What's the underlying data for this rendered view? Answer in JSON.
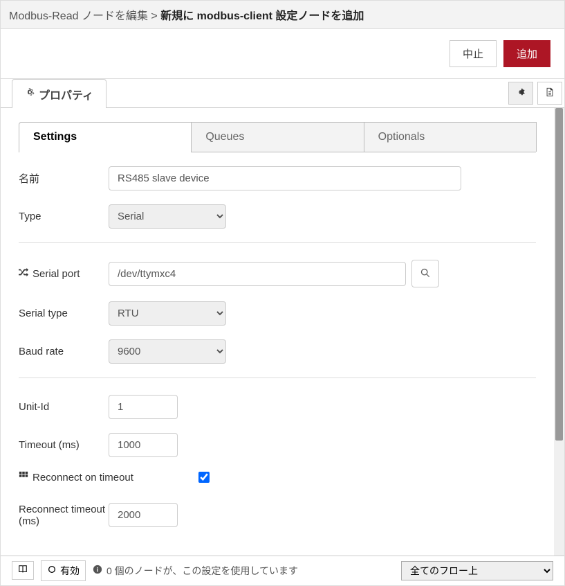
{
  "header": {
    "breadcrumb_prefix": "Modbus-Read ノードを編集 > ",
    "breadcrumb_current": "新規に modbus-client 設定ノードを追加"
  },
  "toolbar": {
    "cancel_label": "中止",
    "add_label": "追加"
  },
  "main_tabs": {
    "properties_label": "プロパティ"
  },
  "inner_tabs": {
    "settings": "Settings",
    "queues": "Queues",
    "optionals": "Optionals"
  },
  "form": {
    "name_label": "名前",
    "name_value": "RS485 slave device",
    "type_label": "Type",
    "type_value": "Serial",
    "serial_port_label": "Serial port",
    "serial_port_value": "/dev/ttymxc4",
    "serial_type_label": "Serial type",
    "serial_type_value": "RTU",
    "baud_rate_label": "Baud rate",
    "baud_rate_value": "9600",
    "unit_id_label": "Unit-Id",
    "unit_id_value": "1",
    "timeout_label": "Timeout (ms)",
    "timeout_value": "1000",
    "reconnect_on_timeout_label": "Reconnect on timeout",
    "reconnect_on_timeout_checked": true,
    "reconnect_timeout_label": "Reconnect timeout (ms)",
    "reconnect_timeout_value": "2000"
  },
  "footer": {
    "enable_label": "有効",
    "usage_text": "0 個のノードが、この設定を使用しています",
    "scope_value": "全てのフロー上"
  }
}
